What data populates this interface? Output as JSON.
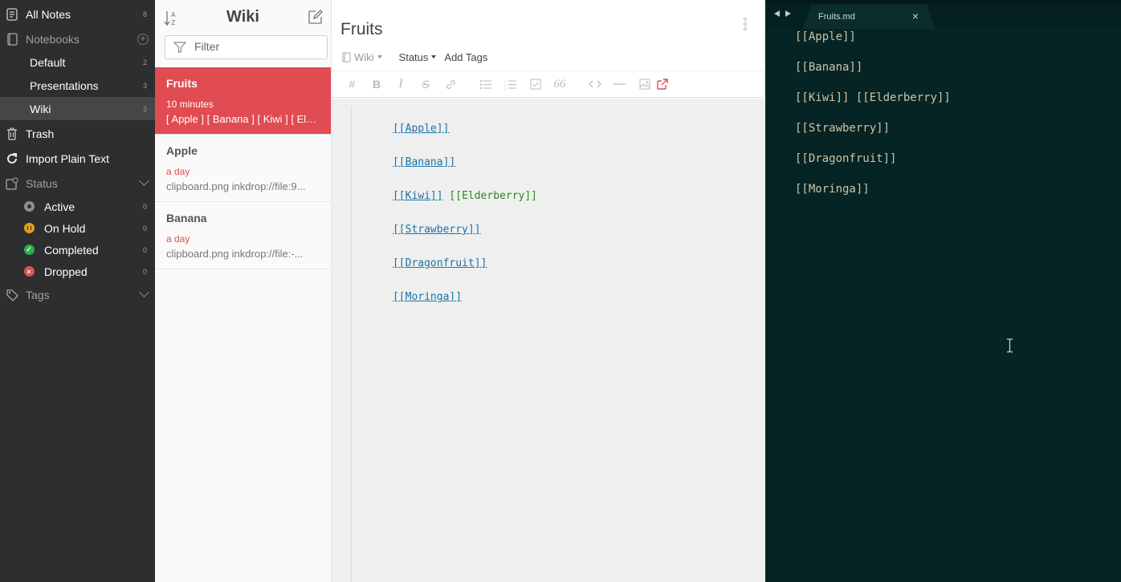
{
  "sidebar": {
    "all_notes": {
      "label": "All Notes",
      "count": "8"
    },
    "notebooks": {
      "label": "Notebooks",
      "items": [
        {
          "label": "Default",
          "count": "2"
        },
        {
          "label": "Presentations",
          "count": "3"
        },
        {
          "label": "Wiki",
          "count": "3"
        }
      ]
    },
    "trash": "Trash",
    "import": "Import Plain Text",
    "status": {
      "label": "Status",
      "items": [
        {
          "label": "Active",
          "count": "0",
          "color": "#9e9e9e"
        },
        {
          "label": "On Hold",
          "count": "0",
          "color": "#e0a21b"
        },
        {
          "label": "Completed",
          "count": "0",
          "color": "#2fae4e"
        },
        {
          "label": "Dropped",
          "count": "0",
          "color": "#d9534f"
        }
      ]
    },
    "tags": "Tags"
  },
  "notelist": {
    "title": "Wiki",
    "filter_placeholder": "Filter",
    "notes": [
      {
        "title": "Fruits",
        "date": "10 minutes",
        "preview": "[ Apple ] [ Banana ] [ Kiwi ] [ Elderberry ]"
      },
      {
        "title": "Apple",
        "date": "a day",
        "preview": "clipboard.png inkdrop://file:9..."
      },
      {
        "title": "Banana",
        "date": "a day",
        "preview": "clipboard.png inkdrop://file:-..."
      }
    ]
  },
  "editor": {
    "title": "Fruits",
    "notebook": "Wiki",
    "status": "Status",
    "add_tags": "Add Tags",
    "lines": {
      "l1": "[[Apple]]",
      "l2": "[[Banana]]",
      "l3a": "[[Kiwi]]",
      "l3b": "[[Elderberry]]",
      "l4": "[[Strawberry]]",
      "l5": "[[Dragonfruit]]",
      "l6": "[[Moringa]]"
    }
  },
  "external_editor": {
    "tab_label": "Fruits.md",
    "lines": [
      "[[Apple]]",
      "[[Banana]]",
      "[[Kiwi]] [[Elderberry]]",
      "[[Strawberry]]",
      "[[Dragonfruit]]",
      "[[Moringa]]"
    ]
  },
  "colors": {
    "accent": "#e14b52",
    "sidebar_bg": "#2d2e2f",
    "external_bg": "#062424",
    "link": "#1a73a8"
  }
}
